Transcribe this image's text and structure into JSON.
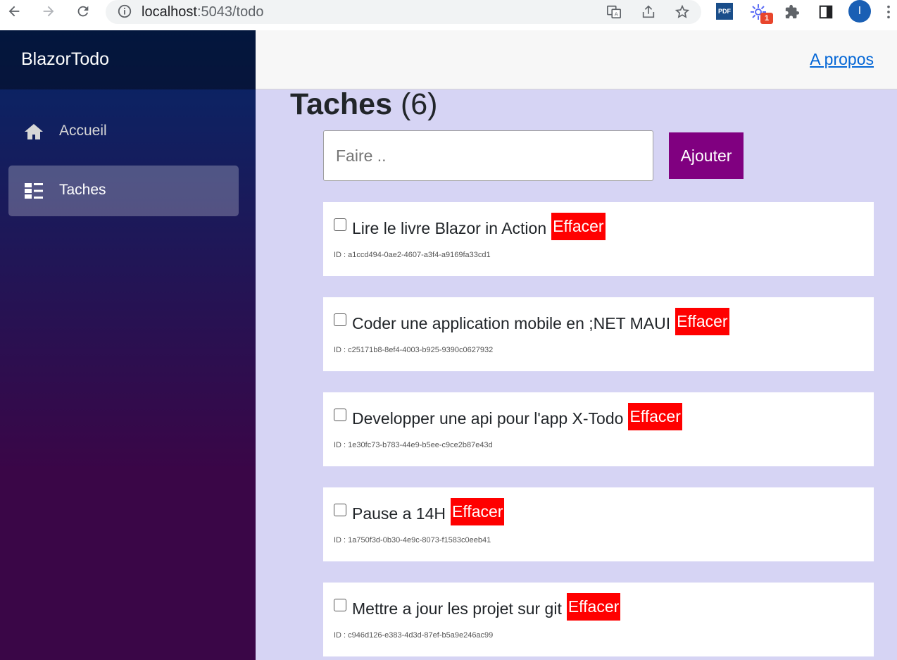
{
  "browser": {
    "url_host": "localhost",
    "url_path": ":5043/todo",
    "profile_initial": "I",
    "extension_badge": "1",
    "pdf_label": "PDF"
  },
  "sidebar": {
    "brand": "BlazorTodo",
    "items": [
      {
        "label": "Accueil",
        "icon": "home-icon",
        "active": false
      },
      {
        "label": "Taches",
        "icon": "list-icon",
        "active": true
      }
    ]
  },
  "top_row": {
    "about_link": "A propos"
  },
  "main": {
    "title": "Taches",
    "count": "(6)",
    "new_todo": {
      "placeholder": "Faire ..",
      "value": ""
    },
    "add_label": "Ajouter",
    "todos": [
      {
        "title": "Lire le livre Blazor in Action",
        "delete_label": "Effacer",
        "id_text": "ID : a1ccd494-0ae2-4607-a3f4-a9169fa33cd1",
        "done": false
      },
      {
        "title": "Coder une application mobile en ;NET MAUI",
        "delete_label": "Effacer",
        "id_text": "ID : c25171b8-8ef4-4003-b925-9390c0627932",
        "done": false
      },
      {
        "title": "Developper une api pour l'app X-Todo",
        "delete_label": "Effacer",
        "id_text": "ID : 1e30fc73-b783-44e9-b5ee-c9ce2b87e43d",
        "done": false
      },
      {
        "title": "Pause a 14H",
        "delete_label": "Effacer",
        "id_text": "ID : 1a750f3d-0b30-4e9c-8073-f1583c0eeb41",
        "done": false
      },
      {
        "title": "Mettre a jour les projet sur git",
        "delete_label": "Effacer",
        "id_text": "ID : c946d126-e383-4d3d-87ef-b5a9e246ac99",
        "done": false
      }
    ]
  },
  "colors": {
    "add_button": "#800080",
    "delete_button": "#ff0000",
    "content_bg": "#d6d4f4",
    "link": "#0366d6"
  }
}
